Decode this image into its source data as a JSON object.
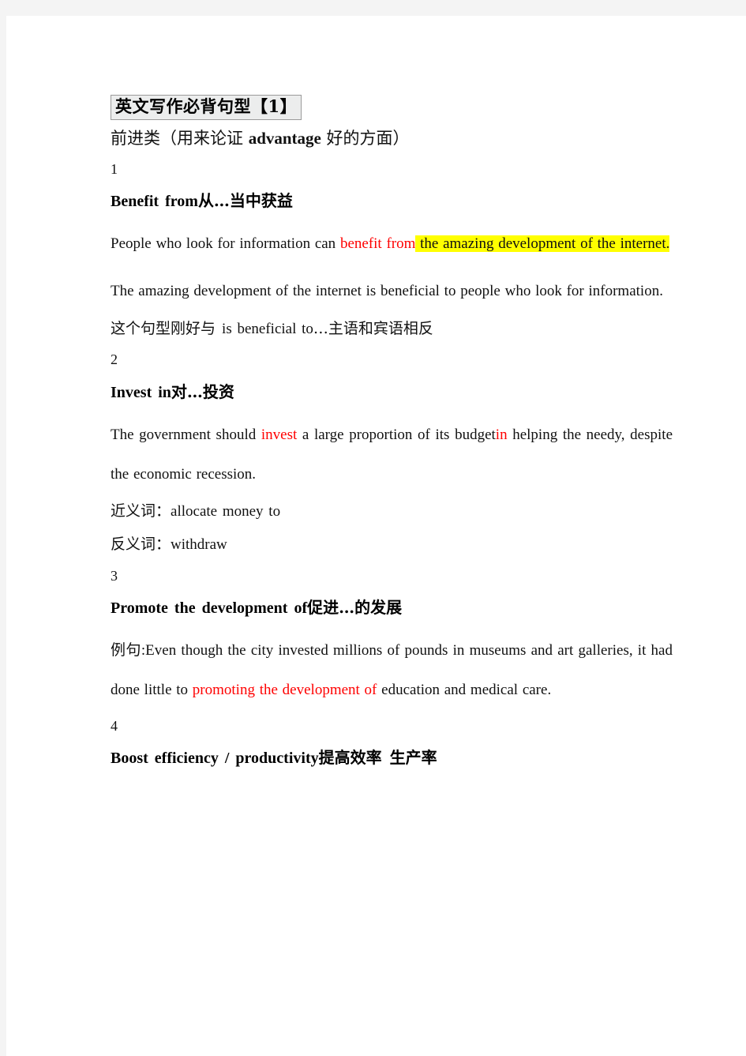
{
  "document": {
    "title_box": "英文写作必背句型【1】",
    "category_line": {
      "prefix": "前进类（用来论证 ",
      "bold_en": "advantage",
      "suffix": " 好的方面）"
    }
  },
  "entries": [
    {
      "number": "1",
      "headword_en": "Benefit from",
      "headword_cn": "从…当中获益",
      "example_1": {
        "plain_before": "People who look for information can ",
        "red": "benefit from",
        "highlight": " the amazing development of the internet."
      },
      "example_2": "The amazing development of the internet is beneficial to people who look for information.",
      "note": {
        "cn_before": "这个句型刚好与 ",
        "en": "is beneficial to",
        "cn_after": "…主语和宾语相反"
      }
    },
    {
      "number": "2",
      "headword_en": "Invest in",
      "headword_cn": "对…投资",
      "example_1": {
        "seg_a": "The government should ",
        "red_a": "invest",
        "seg_b": " a large proportion of its budget",
        "red_b": "in",
        "seg_c": " helping the needy, despite the economic recession."
      },
      "synonym": {
        "label": "近义词：",
        "value": "allocate money to"
      },
      "antonym": {
        "label": "反义词：",
        "value": "withdraw"
      }
    },
    {
      "number": "3",
      "headword_en": "Promote the development of",
      "headword_cn": "促进…的发展",
      "example_1": {
        "label_cn": "例句",
        "seg_a": ":Even though the city invested millions of pounds in museums and art galleries, it had done little to ",
        "red": "promoting the development of",
        "seg_b": " education and medical care."
      }
    },
    {
      "number": "4",
      "headword_en": "Boost efficiency / productivity",
      "headword_cn": "提高效率 生产率"
    }
  ],
  "colors": {
    "emphasis_red": "#ff0000",
    "highlight_yellow": "#ffff00",
    "title_box_fill": "#eceded",
    "title_box_border": "#9a9a9a",
    "page_background": "#f4f4f4",
    "sheet": "#ffffff"
  }
}
